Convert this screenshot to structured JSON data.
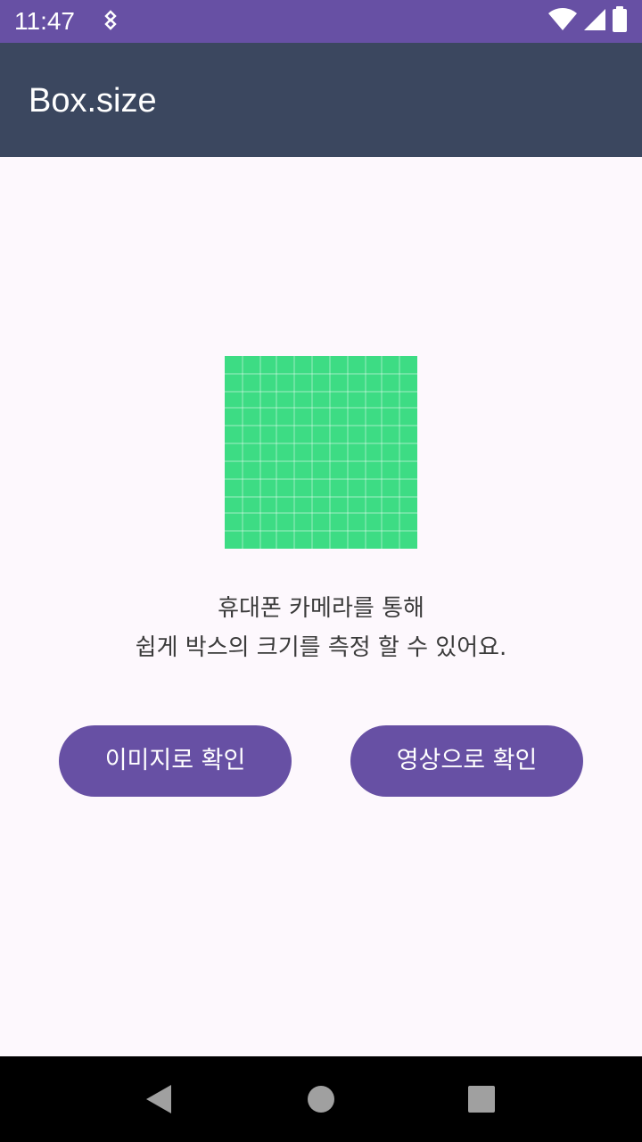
{
  "status_bar": {
    "time": "11:47",
    "background": "#6750a4",
    "icons": [
      "notification-icon",
      "wifi-icon",
      "signal-icon",
      "battery-icon"
    ]
  },
  "app_bar": {
    "title": "Box.size",
    "background": "#3b475f"
  },
  "main": {
    "illustration": "grid-icon",
    "illustration_color": "#3ddc84",
    "description_line1": "휴대폰 카메라를 통해",
    "description_line2": "쉽게 박스의 크기를 측정 할 수 있어요.",
    "buttons": {
      "image_label": "이미지로 확인",
      "video_label": "영상으로 확인",
      "color": "#6750a4"
    }
  },
  "nav_bar": {
    "icons": [
      "back-icon",
      "home-icon",
      "recents-icon"
    ]
  }
}
